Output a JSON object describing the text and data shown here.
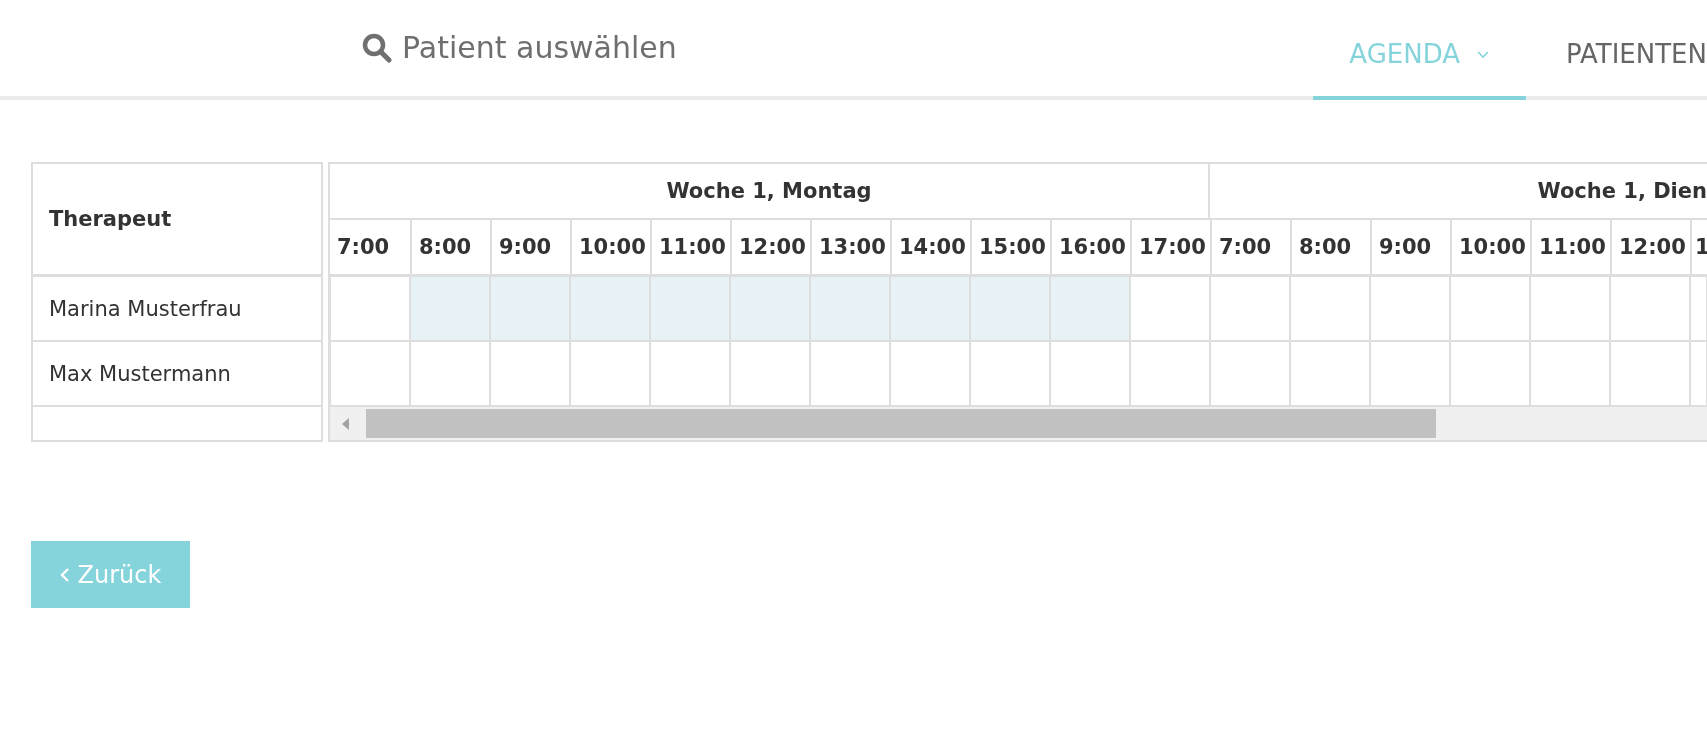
{
  "header": {
    "search": {
      "placeholder": "Patient auswählen"
    },
    "tabs": [
      {
        "label": "AGENDA",
        "selected": true,
        "dropdown": true
      },
      {
        "label": "PATIENTEN",
        "selected": false,
        "dropdown": false
      }
    ]
  },
  "schedule": {
    "name_column": "Therapeut",
    "days": [
      {
        "title": "Woche 1, Montag",
        "hours": [
          "7:00",
          "8:00",
          "9:00",
          "10:00",
          "11:00",
          "12:00",
          "13:00",
          "14:00",
          "15:00",
          "16:00",
          "17:00"
        ]
      },
      {
        "title": "Woche 1, Dien",
        "hours": [
          "7:00",
          "8:00",
          "9:00",
          "10:00",
          "11:00",
          "12:00",
          "1"
        ]
      }
    ],
    "rows": [
      {
        "name": "Marina Musterfrau",
        "slots": [
          {
            "shaded": false
          },
          {
            "shaded": true
          },
          {
            "shaded": true
          },
          {
            "shaded": true
          },
          {
            "shaded": true
          },
          {
            "shaded": true
          },
          {
            "shaded": true
          },
          {
            "shaded": true
          },
          {
            "shaded": true
          },
          {
            "shaded": true
          },
          {
            "shaded": false
          },
          {
            "shaded": false
          },
          {
            "shaded": false
          },
          {
            "shaded": false
          },
          {
            "shaded": false
          },
          {
            "shaded": false
          },
          {
            "shaded": false
          },
          {
            "shaded": false
          }
        ]
      },
      {
        "name": "Max Mustermann",
        "slots": [
          {
            "shaded": false
          },
          {
            "shaded": false
          },
          {
            "shaded": false
          },
          {
            "shaded": false
          },
          {
            "shaded": false
          },
          {
            "shaded": false
          },
          {
            "shaded": false
          },
          {
            "shaded": false
          },
          {
            "shaded": false
          },
          {
            "shaded": false
          },
          {
            "shaded": false
          },
          {
            "shaded": false
          },
          {
            "shaded": false
          },
          {
            "shaded": false
          },
          {
            "shaded": false
          },
          {
            "shaded": false
          },
          {
            "shaded": false
          },
          {
            "shaded": false
          }
        ]
      }
    ]
  },
  "back_button": {
    "label": "Zurück"
  }
}
